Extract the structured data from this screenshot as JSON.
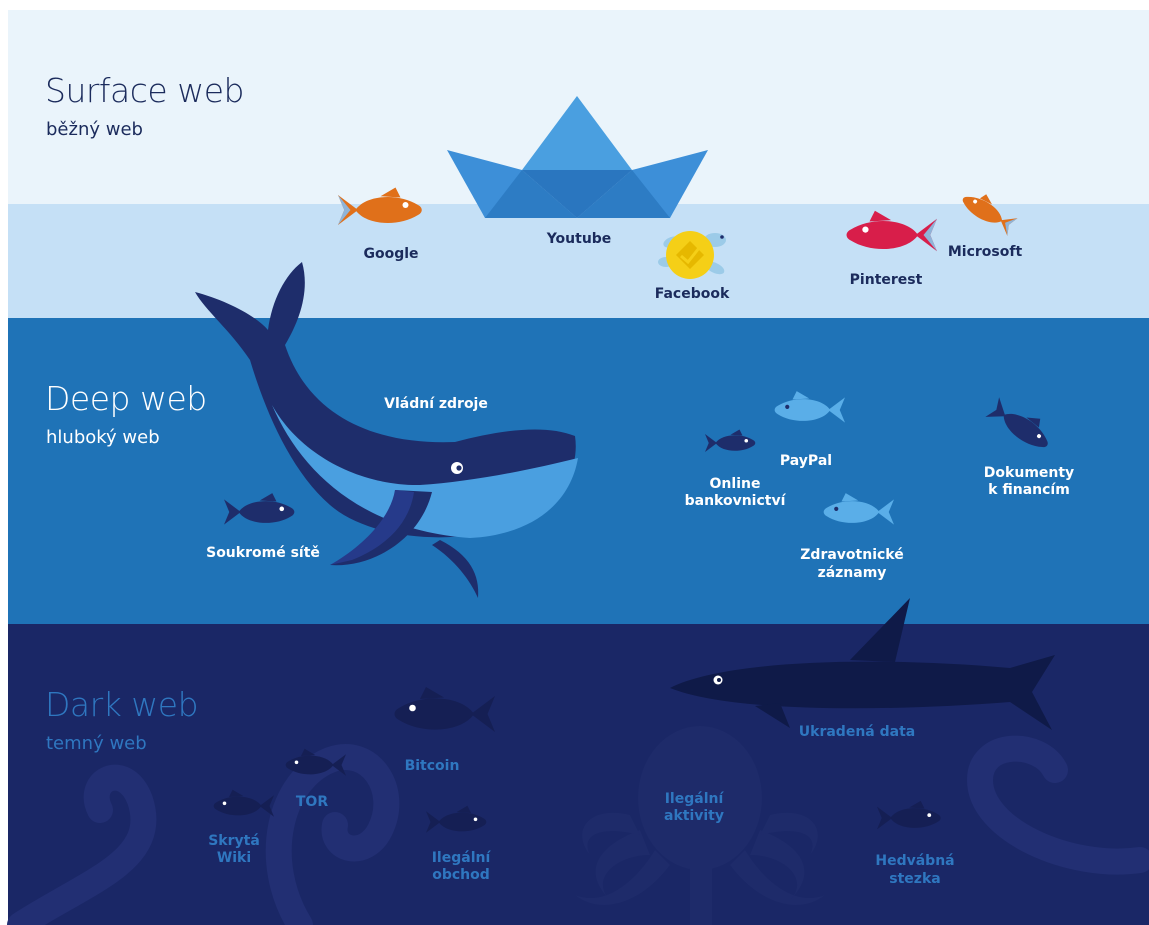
{
  "colors": {
    "sky": "#eaf4fb",
    "surface_water": "#c5e0f6",
    "deep_water": "#1f73b7",
    "dark_water": "#1a2766",
    "surface_text": "#1b2b5c",
    "deep_text": "#ffffff",
    "dark_text": "#2f77c0",
    "orange_fish": "#e0701a",
    "red_fish": "#d81e4a",
    "turtle": "#f5cf17",
    "whale_dark": "#1e2d6b",
    "whale_light": "#4a9fe0",
    "boat": "#3d8fd8"
  },
  "zones": {
    "surface": {
      "title": "Surface web",
      "subtitle": "běžný web"
    },
    "deep": {
      "title": "Deep web",
      "subtitle": "hluboký web"
    },
    "dark": {
      "title": "Dark web",
      "subtitle": "temný web"
    }
  },
  "surface_items": {
    "google": "Google",
    "youtube": "Youtube",
    "facebook": "Facebook",
    "pinterest": "Pinterest",
    "microsoft": "Microsoft"
  },
  "deep_items": {
    "government": "Vládní zdroje",
    "private_networks": "Soukromé sítě",
    "online_banking_1": "Online",
    "online_banking_2": "bankovnictví",
    "paypal": "PayPal",
    "finance_docs_1": "Dokumenty",
    "finance_docs_2": "k financím",
    "medical_1": "Zdravotnické",
    "medical_2": "záznamy"
  },
  "dark_items": {
    "stolen_data": "Ukradená data",
    "bitcoin": "Bitcoin",
    "tor": "TOR",
    "hidden_wiki_1": "Skrytá",
    "hidden_wiki_2": "Wiki",
    "illegal_trade_1": "Ilegální",
    "illegal_trade_2": "obchod",
    "illegal_activities_1": "Ilegální",
    "illegal_activities_2": "aktivity",
    "silk_road_1": "Hedvábná",
    "silk_road_2": "stezka"
  },
  "icons": [
    "paper-boat-icon",
    "fish-icon",
    "turtle-icon",
    "whale-icon",
    "shark-icon",
    "octopus-icon",
    "tentacle-icon"
  ]
}
